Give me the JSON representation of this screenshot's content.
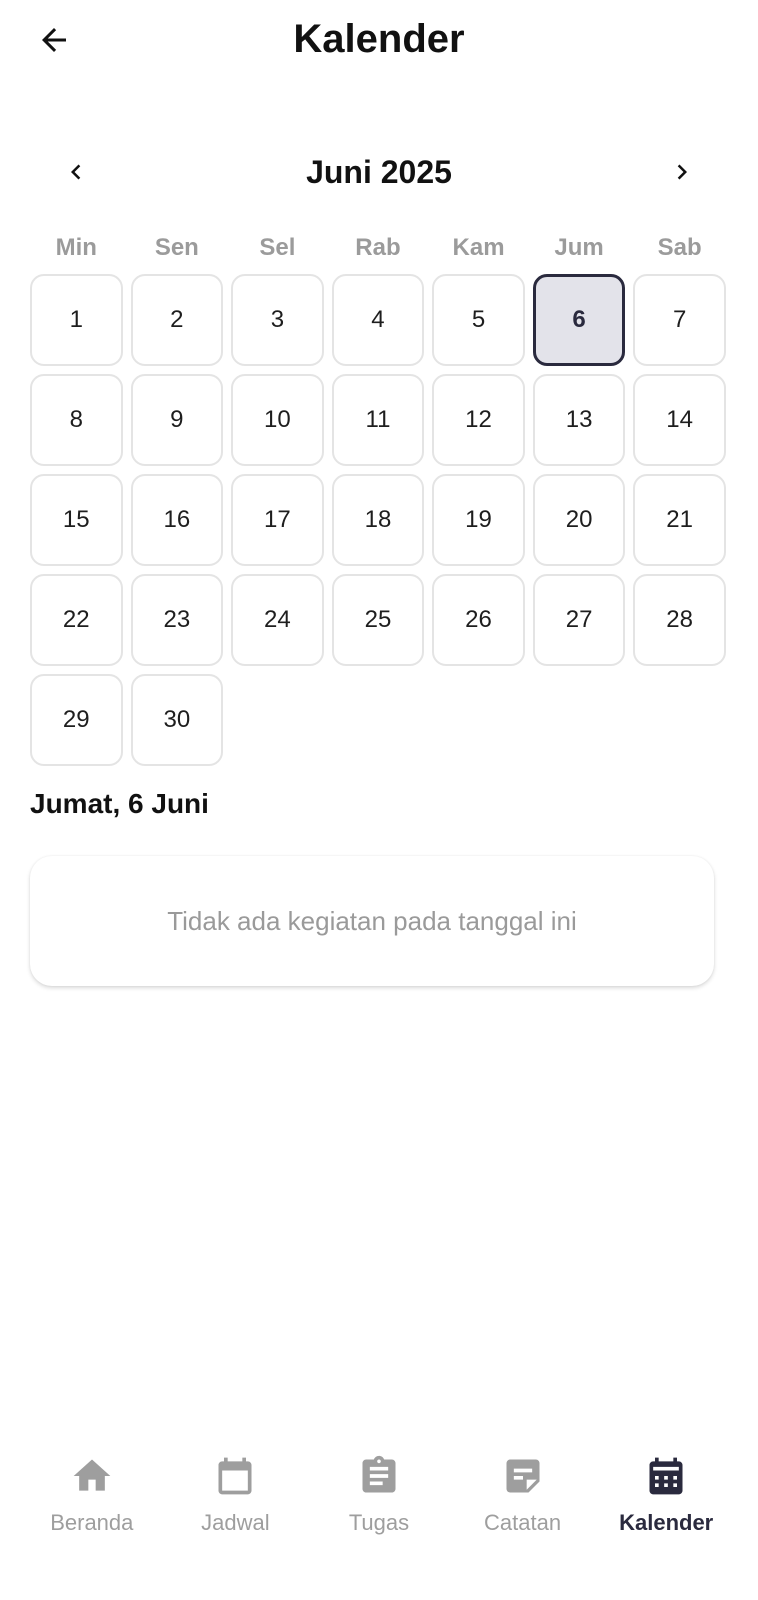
{
  "header": {
    "title": "Kalender",
    "back_icon": "arrow-left-icon"
  },
  "calendar": {
    "month_label": "Juni 2025",
    "prev_icon": "chevron-left-icon",
    "next_icon": "chevron-right-icon",
    "weekdays": [
      "Min",
      "Sen",
      "Sel",
      "Rab",
      "Kam",
      "Jum",
      "Sab"
    ],
    "days": [
      "1",
      "2",
      "3",
      "4",
      "5",
      "6",
      "7",
      "8",
      "9",
      "10",
      "11",
      "12",
      "13",
      "14",
      "15",
      "16",
      "17",
      "18",
      "19",
      "20",
      "21",
      "22",
      "23",
      "24",
      "25",
      "26",
      "27",
      "28",
      "29",
      "30"
    ],
    "selected_day": "6"
  },
  "selected": {
    "date_label": "Jumat, 6 Juni",
    "empty_message": "Tidak ada kegiatan pada tanggal ini"
  },
  "bottom_nav": {
    "items": [
      {
        "label": "Beranda",
        "icon": "home-icon"
      },
      {
        "label": "Jadwal",
        "icon": "calendar-outline-icon"
      },
      {
        "label": "Tugas",
        "icon": "clipboard-icon"
      },
      {
        "label": "Catatan",
        "icon": "note-icon"
      },
      {
        "label": "Kalender",
        "icon": "calendar-grid-icon"
      }
    ],
    "active_label": "Kalender"
  },
  "colors": {
    "accent": "#2a2a3e",
    "selected_fill": "#e3e3ea",
    "muted_text": "#9e9e9e",
    "cell_border": "#e4e4e4"
  }
}
